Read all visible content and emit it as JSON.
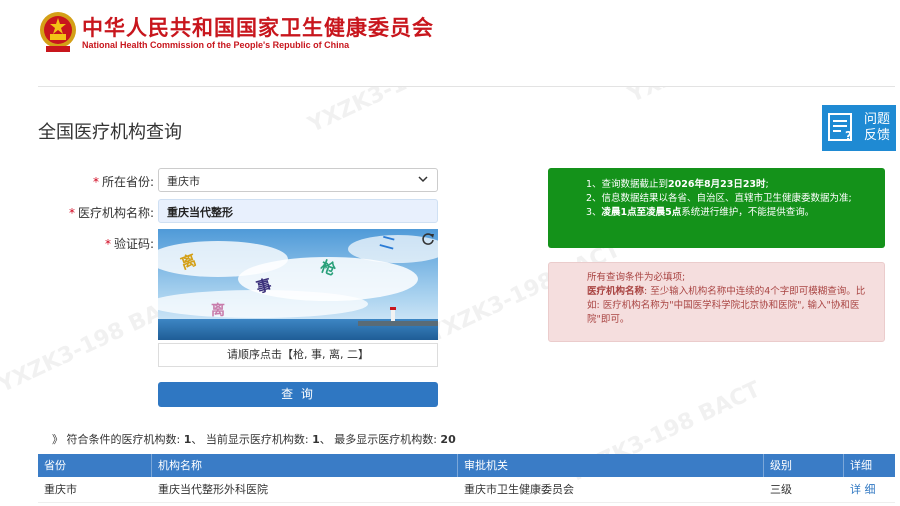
{
  "header": {
    "title": "中华人民共和国国家卫生健康委员会",
    "subtitle": "National Health Commission of the People's Republic of China"
  },
  "page_title": "全国医疗机构查询",
  "feedback": {
    "label": "问题\n反馈",
    "icon": "feedback-icon"
  },
  "form": {
    "province_label": "所在省份:",
    "province_value": "重庆市",
    "org_label": "医疗机构名称:",
    "org_value": "重庆当代整形",
    "captcha_label": "验证码:",
    "captcha_chars": [
      "二",
      "离",
      "事",
      "枪",
      "事",
      "离"
    ],
    "captcha_hint": "请顺序点击【枪, 事, 离, 二】",
    "submit_label": "查 询"
  },
  "notice_green": {
    "line1_pre": "1、查询数据截止到",
    "line1_bold": "2026年8月23日23时",
    "line1_post": ";",
    "line2": "2、信息数据结果以各省、自治区、直辖市卫生健康委数据为准;",
    "line3_pre": "3、",
    "line3_bold": "凌晨1点至凌晨5点",
    "line3_post": "系统进行维护，不能提供查询。"
  },
  "notice_pink": {
    "line1": "所有查询条件为必填项;",
    "line2_bold": "医疗机构名称",
    "line2": ": 至少输入机构名称中连续的4个字即可模糊查询。比如: 医疗机构名称为\"中国医学科学院北京协和医院\", 输入\"协和医院\"即可。"
  },
  "summary": {
    "prefix": "》 符合条件的医疗机构数:",
    "match_count": "1",
    "shown_label": "、 当前显示医疗机构数:",
    "shown_count": "1",
    "max_label": "、 最多显示医疗机构数:",
    "max_count": "20"
  },
  "table": {
    "headers": [
      "省份",
      "机构名称",
      "审批机关",
      "级别",
      "详细"
    ],
    "rows": [
      {
        "province": "重庆市",
        "name": "重庆当代整形外科医院",
        "authority": "重庆市卫生健康委员会",
        "level": "三级",
        "detail": "详 细"
      }
    ]
  },
  "colors": {
    "brand_red": "#c8161d",
    "primary_blue": "#2f77c2",
    "notice_green": "#14921a",
    "notice_pink": "#f5dede"
  }
}
